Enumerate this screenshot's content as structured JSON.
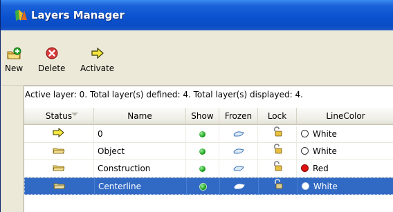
{
  "window": {
    "title": "Layers Manager"
  },
  "toolbar": {
    "new_label": "New",
    "delete_label": "Delete",
    "activate_label": "Activate"
  },
  "info_bar": "Active layer: 0. Total layer(s) defined: 4. Total layer(s) displayed: 4.",
  "columns": [
    "Status",
    "Name",
    "Show",
    "Frozen",
    "Lock",
    "LineColor"
  ],
  "layers": [
    {
      "status": "active-arrow-icon",
      "name": "0",
      "show": true,
      "frozen": false,
      "lock": "unlocked",
      "color_name": "White",
      "color": "#ffffff"
    },
    {
      "status": "folder-icon",
      "name": "Object",
      "show": true,
      "frozen": false,
      "lock": "unlocked",
      "color_name": "White",
      "color": "#ffffff"
    },
    {
      "status": "folder-icon",
      "name": "Construction",
      "show": true,
      "frozen": false,
      "lock": "unlocked",
      "color_name": "Red",
      "color": "#dd1111"
    },
    {
      "status": "folder-icon",
      "name": "Centerline",
      "show": true,
      "frozen": false,
      "lock": "unlocked",
      "color_name": "White",
      "color": "#ffffff",
      "selected": true
    }
  ],
  "colors": {
    "title_bar": "#0a52d0",
    "selection": "#316ac5",
    "window_bg": "#ece9d8"
  }
}
